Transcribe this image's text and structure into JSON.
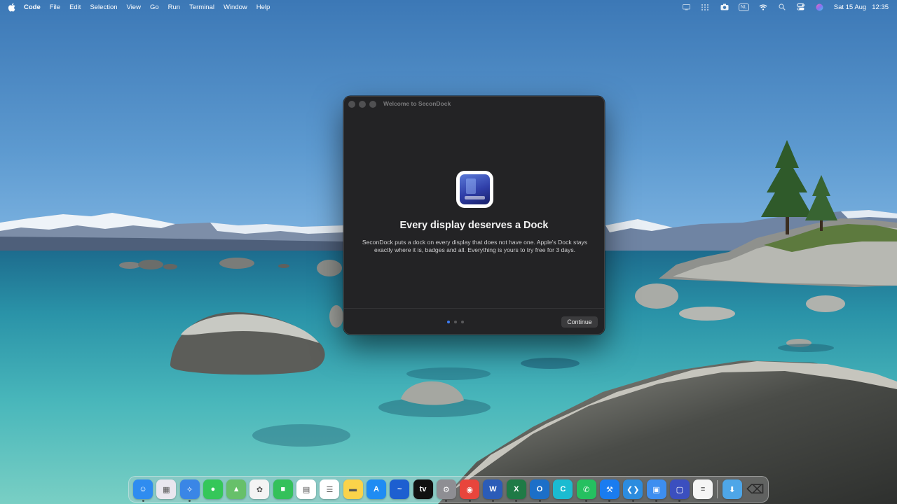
{
  "menubar": {
    "app_name": "Code",
    "items": [
      "File",
      "Edit",
      "Selection",
      "View",
      "Go",
      "Run",
      "Terminal",
      "Window",
      "Help"
    ],
    "status_icons": [
      "display-icon",
      "grid-icon",
      "camera-icon",
      "keyboard-layout",
      "wifi-icon",
      "search-icon",
      "control-center-icon",
      "siri-icon"
    ],
    "keyboard_layout": "NL",
    "date": "Sat 15 Aug",
    "time": "12:35"
  },
  "dialog": {
    "window_title": "Welcome to SeconDock",
    "headline": "Every display deserves a Dock",
    "body": "SeconDock puts a dock on every display that does not have one. Apple's Dock stays exactly where it is, badges and all. Everything is yours to try free for 3 days.",
    "page_count": 3,
    "active_page": 1,
    "continue_label": "Continue"
  },
  "dock": {
    "apps": [
      {
        "name": "finder",
        "glyph": "☺",
        "color": "#2f8cf0",
        "running": true
      },
      {
        "name": "launchpad",
        "glyph": "▦",
        "color": "#e9e7ef",
        "running": false
      },
      {
        "name": "safari",
        "glyph": "✧",
        "color": "#3a86e6",
        "running": true
      },
      {
        "name": "messages",
        "glyph": "●",
        "color": "#35c759",
        "running": false
      },
      {
        "name": "maps",
        "glyph": "▲",
        "color": "#67c06a",
        "running": false
      },
      {
        "name": "photos",
        "glyph": "✿",
        "color": "#f4f4f4",
        "running": false
      },
      {
        "name": "facetime",
        "glyph": "■",
        "color": "#34c15a",
        "running": false
      },
      {
        "name": "calendar",
        "glyph": "▤",
        "color": "#ffffff",
        "running": false
      },
      {
        "name": "reminders",
        "glyph": "☰",
        "color": "#ffffff",
        "running": false
      },
      {
        "name": "notes",
        "glyph": "▬",
        "color": "#fbd34a",
        "running": false
      },
      {
        "name": "app-store",
        "glyph": "A",
        "color": "#1f8cf3",
        "running": false
      },
      {
        "name": "freeform",
        "glyph": "~",
        "color": "#1d5fd0",
        "running": false
      },
      {
        "name": "apple-tv",
        "glyph": "tv",
        "color": "#111111",
        "running": false
      },
      {
        "name": "system-settings",
        "glyph": "⚙",
        "color": "#8e8e93",
        "running": true
      },
      {
        "name": "chrome",
        "glyph": "◉",
        "color": "#e8453c",
        "running": true
      },
      {
        "name": "word",
        "glyph": "W",
        "color": "#2b5cb8",
        "running": true
      },
      {
        "name": "excel",
        "glyph": "X",
        "color": "#1f7a46",
        "running": true
      },
      {
        "name": "outlook",
        "glyph": "O",
        "color": "#1c6fc8",
        "running": true
      },
      {
        "name": "canva",
        "glyph": "C",
        "color": "#1bbbd1",
        "running": false
      },
      {
        "name": "whatsapp",
        "glyph": "✆",
        "color": "#25c060",
        "running": true
      },
      {
        "name": "xcode",
        "glyph": "⚒",
        "color": "#1a7cf0",
        "running": true
      },
      {
        "name": "vscode",
        "glyph": "❮❯",
        "color": "#2c8cdf",
        "running": true
      },
      {
        "name": "preview",
        "glyph": "▣",
        "color": "#3d8ef0",
        "running": true
      },
      {
        "name": "secondock",
        "glyph": "▢",
        "color": "#3b4fbf",
        "running": true
      },
      {
        "name": "textedit",
        "glyph": "≡",
        "color": "#f5f5f5",
        "running": false
      }
    ],
    "folders": [
      {
        "name": "downloads-folder",
        "glyph": "⬇",
        "color": "#4ea6e8"
      },
      {
        "name": "trash",
        "glyph": "⌫",
        "color": "#3a3a3c"
      }
    ]
  }
}
